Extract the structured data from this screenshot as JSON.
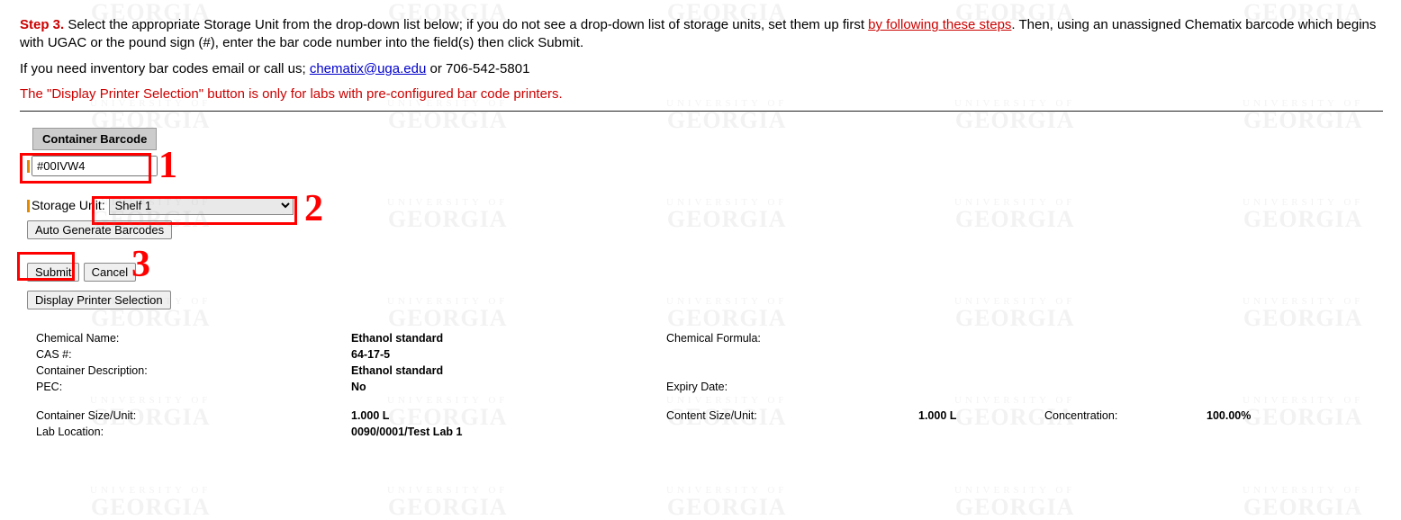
{
  "watermark": {
    "small": "UNIVERSITY OF",
    "big": "GEORGIA"
  },
  "instructions": {
    "step_label": "Step 3.",
    "step_text_a": "  Select the appropriate Storage Unit from the drop-down list below; if you do not see a drop-down list of storage units, set them up first ",
    "link_steps": "by following these steps",
    "step_text_b": ".  Then, using an unassigned Chematix barcode which begins with UGAC or the pound sign (#), enter the bar code number into the field(s) then click Submit.",
    "help_a": "If you need inventory bar codes email or call us; ",
    "email": "chematix@uga.edu",
    "help_b": " or 706-542-5801",
    "printer_note": "The \"Display Printer Selection\" button is only for labs with pre-configured bar code printers."
  },
  "form": {
    "container_barcode_header": "Container Barcode",
    "barcode_value": "#00IVW4",
    "storage_unit_label": "Storage Unit:",
    "storage_unit_value": "Shelf 1",
    "auto_generate": "Auto Generate Barcodes",
    "submit": "Submit",
    "cancel": "Cancel",
    "display_printer": "Display Printer Selection"
  },
  "annotations": {
    "one": "1",
    "two": "2",
    "three": "3"
  },
  "details": {
    "chemical_name_lbl": "Chemical Name:",
    "chemical_name_val": "Ethanol standard",
    "cas_lbl": "CAS #:",
    "cas_val": "64-17-5",
    "desc_lbl": "Container Description:",
    "desc_val": "Ethanol standard",
    "pec_lbl": "PEC:",
    "pec_val": "No",
    "formula_lbl": "Chemical Formula:",
    "formula_val": "",
    "expiry_lbl": "Expiry Date:",
    "expiry_val": "",
    "size_lbl": "Container Size/Unit:",
    "size_val": "1.000 L",
    "content_lbl": "Content Size/Unit:",
    "content_val": "1.000 L",
    "conc_lbl": "Concentration:",
    "conc_val": "100.00%",
    "lab_lbl": "Lab Location:",
    "lab_val": "0090/0001/Test Lab 1"
  }
}
